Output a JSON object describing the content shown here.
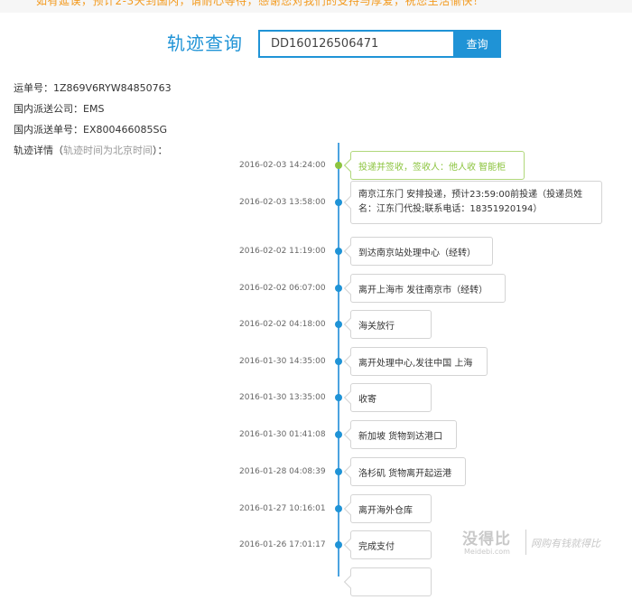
{
  "notice": {
    "text": "如有延误，预计2-3天到国内，请耐心等待，感谢您对我们的支持与厚爱，祝您生活愉快！"
  },
  "search": {
    "title": "轨迹查询",
    "value": "DD160126506471",
    "button_label": "查询"
  },
  "info": {
    "tracking_number": "运单号：1Z869V6RYW84850763",
    "courier": "国内派送公司：EMS",
    "domestic_number": "国内派送单号：EX800466085SG",
    "details_label": "轨迹详情（",
    "details_note": "轨迹时间为北京时间",
    "details_suffix": "）："
  },
  "timeline": [
    {
      "time": "2016-02-03 14:24:00",
      "text": "投递并签收，签收人：他人收 智能柜",
      "current": true
    },
    {
      "time": "2016-02-03 13:58:00",
      "text": "南京江东门 安排投递，预计23:59:00前投递（投递员姓名：江东门代投;联系电话：18351920194）",
      "current": false
    },
    {
      "time": "2016-02-02 11:19:00",
      "text": "到达南京站处理中心（经转）",
      "current": false
    },
    {
      "time": "2016-02-02 06:07:00",
      "text": "离开上海市 发往南京市（经转）",
      "current": false
    },
    {
      "time": "2016-02-02 04:18:00",
      "text": "海关放行",
      "current": false
    },
    {
      "time": "2016-01-30 14:35:00",
      "text": "离开处理中心,发往中国 上海",
      "current": false
    },
    {
      "time": "2016-01-30 13:35:00",
      "text": "收寄",
      "current": false
    },
    {
      "time": "2016-01-30 01:41:08",
      "text": "新加坡 货物到达港口",
      "current": false
    },
    {
      "time": "2016-01-28 04:08:39",
      "text": "洛杉矶 货物离开起运港",
      "current": false
    },
    {
      "time": "2016-01-27 10:16:01",
      "text": "离开海外仓库",
      "current": false
    },
    {
      "time": "2016-01-26 17:01:17",
      "text": "完成支付",
      "current": false
    },
    {
      "time": "",
      "text": "",
      "current": false
    }
  ],
  "watermark": {
    "logo": "没得比",
    "url": "Meidebi.com",
    "slogan": "网购有钱就得比"
  },
  "colors": {
    "accent": "#1f93d6",
    "current": "#8cc43f",
    "notice": "#f39a1e"
  }
}
